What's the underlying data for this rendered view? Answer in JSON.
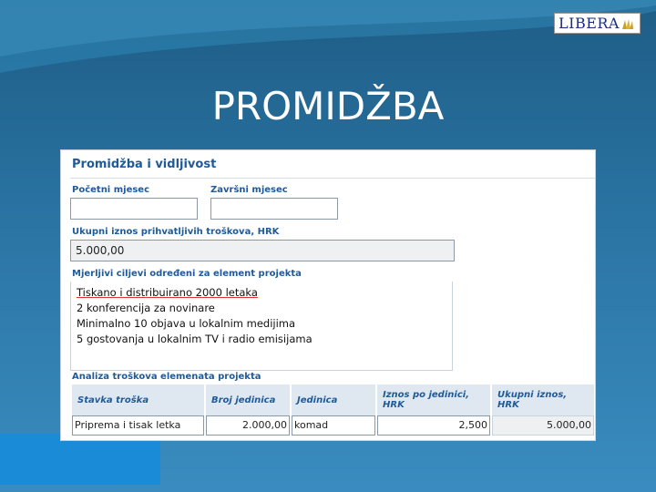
{
  "slide": {
    "title": "PROMIDŽBA",
    "logo_text": "LIBERA"
  },
  "form": {
    "section_title": "Promidžba i vidljivost",
    "start_month_label": "Početni mjesec",
    "start_month_value": "",
    "end_month_label": "Završni mjesec",
    "end_month_value": "",
    "total_label": "Ukupni iznos prihvatljivih troškova, HRK",
    "total_value": "5.000,00",
    "goals_label": "Mjerljivi ciljevi određeni za element projekta",
    "goals_lines": [
      "Tiskano i distribuirano 2000 letaka",
      "2 konferencija za novinare",
      "Minimalno 10 objava u lokalnim medijima",
      "5 gostovanja u lokalnim TV i radio emisijama"
    ],
    "analysis_label": "Analiza troškova elemenata projekta",
    "table": {
      "headers": [
        "Stavka troška",
        "Broj jedinica",
        "Jedinica",
        "Iznos po jedinici, HRK",
        "Ukupni iznos, HRK"
      ],
      "rows": [
        [
          "Priprema i tisak letka",
          "2.000,00",
          "komad",
          "2,500",
          "5.000,00"
        ]
      ]
    }
  },
  "colors": {
    "background_top": "#1e5d86",
    "background_bottom": "#3a8cc0",
    "label_blue": "#1f5a99",
    "corner_block": "#1a8bd6"
  }
}
